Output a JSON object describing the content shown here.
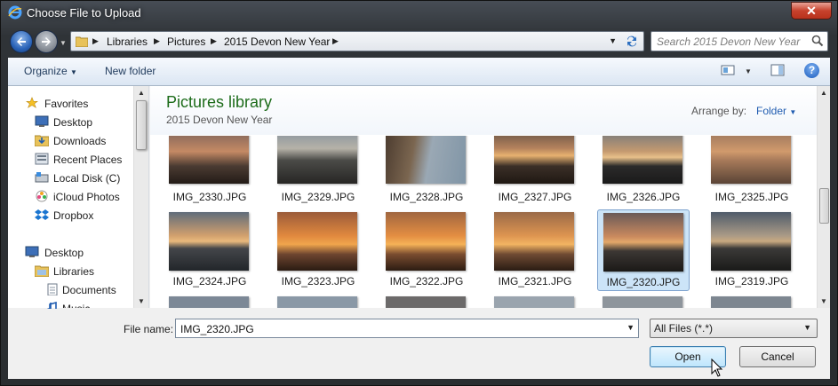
{
  "window": {
    "title": "Choose File to Upload",
    "close_glyph": "✕"
  },
  "nav": {
    "breadcrumbs": [
      "Libraries",
      "Pictures",
      "2015 Devon New Year"
    ],
    "search_placeholder": "Search 2015 Devon New Year"
  },
  "toolbar": {
    "organize": "Organize",
    "new_folder": "New folder",
    "help_glyph": "?"
  },
  "sidebar": {
    "items": [
      {
        "label": "Favorites",
        "icon": "star-icon"
      },
      {
        "label": "Desktop",
        "icon": "desktop-icon"
      },
      {
        "label": "Downloads",
        "icon": "downloads-icon"
      },
      {
        "label": "Recent Places",
        "icon": "recent-places-icon"
      },
      {
        "label": "Local Disk (C)",
        "icon": "drive-icon"
      },
      {
        "label": "iCloud Photos",
        "icon": "icloud-icon"
      },
      {
        "label": "Dropbox",
        "icon": "dropbox-icon"
      },
      {
        "label": "Desktop",
        "icon": "desktop-icon"
      },
      {
        "label": "Libraries",
        "icon": "libraries-icon"
      },
      {
        "label": "Documents",
        "icon": "documents-icon"
      },
      {
        "label": "Music",
        "icon": "music-icon"
      }
    ]
  },
  "library": {
    "title": "Pictures library",
    "subtitle": "2015 Devon New Year",
    "arrange_label": "Arrange by:",
    "arrange_value": "Folder"
  },
  "files": [
    {
      "name": "IMG_2330.JPG"
    },
    {
      "name": "IMG_2329.JPG"
    },
    {
      "name": "IMG_2328.JPG"
    },
    {
      "name": "IMG_2327.JPG"
    },
    {
      "name": "IMG_2326.JPG"
    },
    {
      "name": "IMG_2325.JPG"
    },
    {
      "name": "IMG_2324.JPG"
    },
    {
      "name": "IMG_2323.JPG"
    },
    {
      "name": "IMG_2322.JPG"
    },
    {
      "name": "IMG_2321.JPG"
    },
    {
      "name": "IMG_2320.JPG",
      "selected": true
    },
    {
      "name": "IMG_2319.JPG"
    }
  ],
  "bottom": {
    "file_name_label": "File name:",
    "file_name_value": "IMG_2320.JPG",
    "file_type": "All Files (*.*)",
    "open": "Open",
    "cancel": "Cancel"
  },
  "colors": {
    "accent": "#1d6c1a",
    "selection": "#cce4f8",
    "link": "#1f5cb0"
  }
}
